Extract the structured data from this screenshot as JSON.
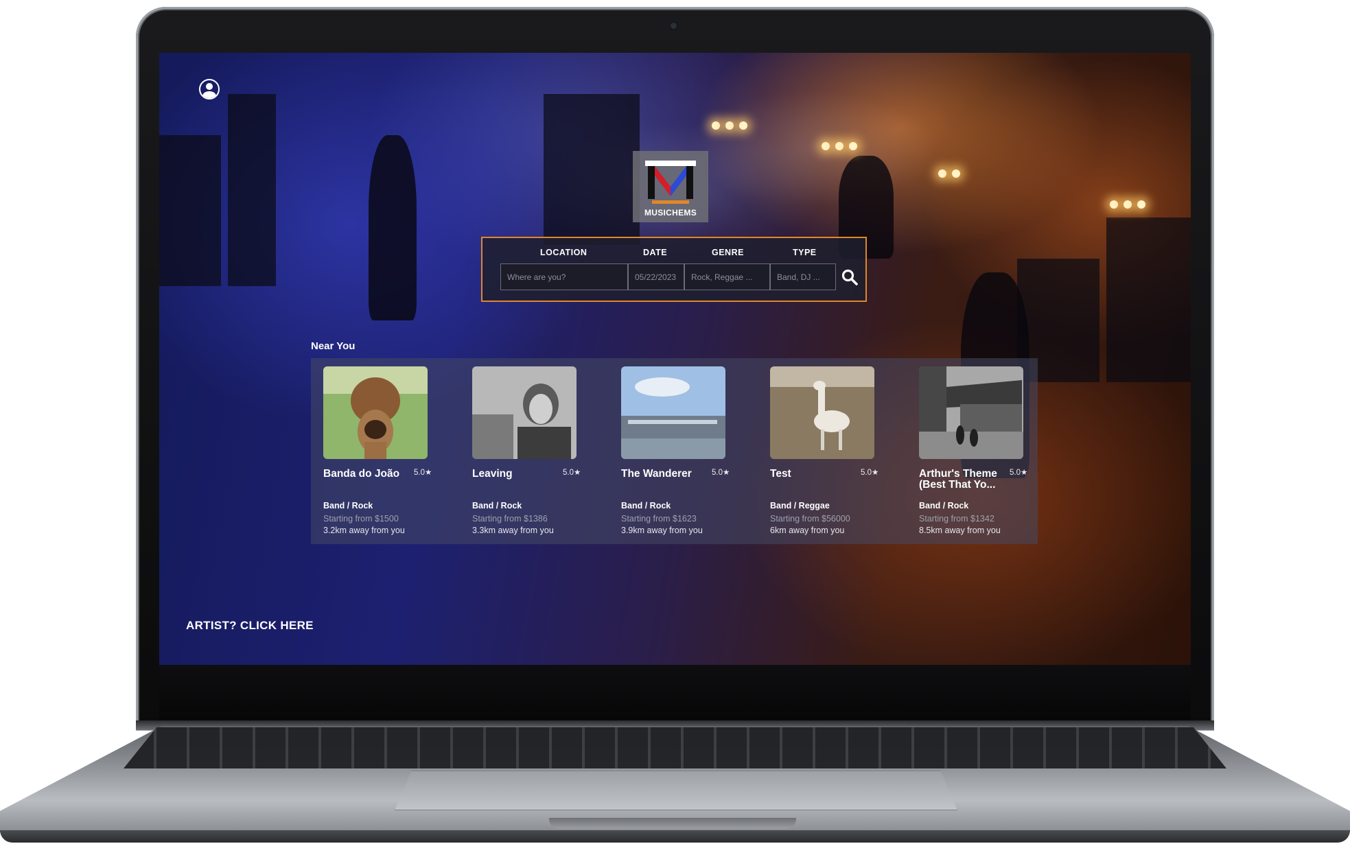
{
  "brand": {
    "name": "MUSICHEMS",
    "accent": "#e2872a"
  },
  "header": {
    "user_icon": "user-circle-icon"
  },
  "search": {
    "location_label": "LOCATION",
    "date_label": "DATE",
    "genre_label": "GENRE",
    "type_label": "TYPE",
    "location_placeholder": "Where are you?",
    "date_placeholder": "05/22/2023",
    "genre_placeholder": "Rock, Reggae ...",
    "type_placeholder": "Band, DJ ...",
    "button_icon": "search-icon"
  },
  "near_you": {
    "title": "Near You",
    "cards": [
      {
        "name": "Banda do João",
        "rating": "5.0★",
        "genre": "Band / Rock",
        "price": "Starting from $1500",
        "distance": "3.2km away from you"
      },
      {
        "name": "Leaving",
        "rating": "5.0★",
        "genre": "Band / Rock",
        "price": "Starting from $1386",
        "distance": "3.3km away from you"
      },
      {
        "name": "The Wanderer",
        "rating": "5.0★",
        "genre": "Band / Rock",
        "price": "Starting from $1623",
        "distance": "3.9km away from you"
      },
      {
        "name": "Test",
        "rating": "5.0★",
        "genre": "Band / Reggae",
        "price": "Starting from $56000",
        "distance": "6km away from you"
      },
      {
        "name": "Arthur's Theme (Best That Yo...",
        "rating": "5.0★",
        "genre": "Band / Rock",
        "price": "Starting from $1342",
        "distance": "8.5km away from you"
      }
    ]
  },
  "footer": {
    "artist_link": "ARTIST? CLICK HERE"
  }
}
